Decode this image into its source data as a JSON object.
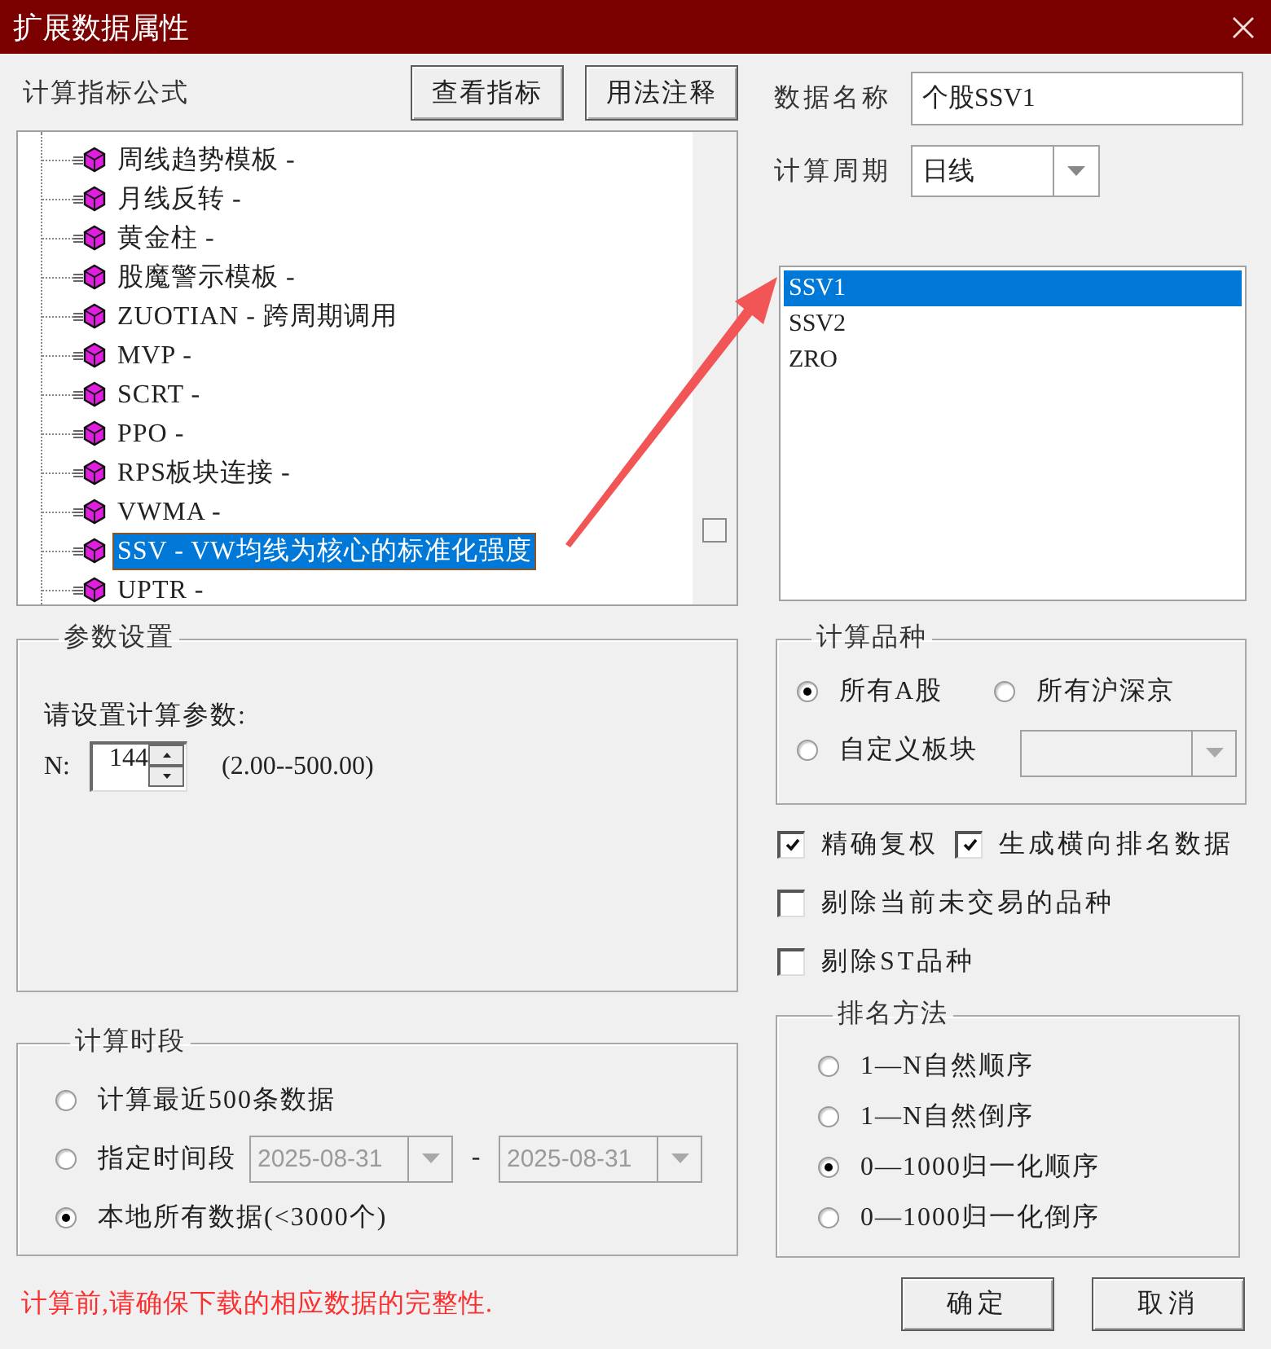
{
  "window": {
    "title": "扩展数据属性"
  },
  "formula": {
    "label": "计算指标公式",
    "buttons": [
      "查看指标",
      "用法注释"
    ],
    "tree": [
      {
        "label": "周线趋势模板 -",
        "selected": false
      },
      {
        "label": "月线反转 -",
        "selected": false
      },
      {
        "label": "黄金柱 -",
        "selected": false
      },
      {
        "label": "股魔警示模板 -",
        "selected": false
      },
      {
        "label": "ZUOTIAN - 跨周期调用",
        "selected": false
      },
      {
        "label": "MVP -",
        "selected": false
      },
      {
        "label": "SCRT -",
        "selected": false
      },
      {
        "label": "PPO -",
        "selected": false
      },
      {
        "label": "RPS板块连接 -",
        "selected": false
      },
      {
        "label": "VWMA -",
        "selected": false
      },
      {
        "label": "SSV - VW均线为核心的标准化强度",
        "selected": true
      },
      {
        "label": "UPTR -",
        "selected": false
      }
    ]
  },
  "data_name": {
    "label": "数据名称",
    "value": "个股SSV1"
  },
  "period": {
    "label": "计算周期",
    "value": "日线"
  },
  "outputs": [
    {
      "label": "SSV1",
      "selected": true
    },
    {
      "label": "SSV2",
      "selected": false
    },
    {
      "label": "ZRO",
      "selected": false
    }
  ],
  "params": {
    "title": "参数设置",
    "prompt": "请设置计算参数:",
    "fields": [
      {
        "label": "N:",
        "value": "144",
        "range": "(2.00--500.00)"
      }
    ]
  },
  "universe": {
    "title": "计算品种",
    "options": [
      {
        "label": "所有A股",
        "selected": true,
        "kind": "plain"
      },
      {
        "label": "所有沪深京",
        "selected": false,
        "kind": "plain"
      },
      {
        "label": "自定义板块",
        "selected": false,
        "kind": "combo",
        "combo_disabled": true
      }
    ]
  },
  "checkbox_rows": [
    [
      {
        "label": "精确复权",
        "checked": true
      },
      {
        "label": "生成横向排名数据",
        "checked": true
      }
    ],
    [
      {
        "label": "剔除当前未交易的品种",
        "checked": false
      }
    ],
    [
      {
        "label": "剔除ST品种",
        "checked": false
      }
    ]
  ],
  "time_range": {
    "title": "计算时段",
    "options": [
      {
        "label": "计算最近500条数据",
        "selected": false,
        "kind": "plain"
      },
      {
        "label": "指定时间段",
        "selected": false,
        "kind": "range",
        "from": "2025-08-31",
        "separator": "-",
        "to": "2025-08-31",
        "disabled": true
      },
      {
        "label": "本地所有数据(<3000个)",
        "selected": true,
        "kind": "plain"
      }
    ]
  },
  "ranking": {
    "title": "排名方法",
    "options": [
      {
        "label": "1—N自然顺序",
        "selected": false
      },
      {
        "label": "1—N自然倒序",
        "selected": false
      },
      {
        "label": "0—1000归一化顺序",
        "selected": true
      },
      {
        "label": "0—1000归一化倒序",
        "selected": false
      }
    ]
  },
  "note": "计算前,请确保下载的相应数据的完整性.",
  "buttons": [
    "确定",
    "取消"
  ]
}
